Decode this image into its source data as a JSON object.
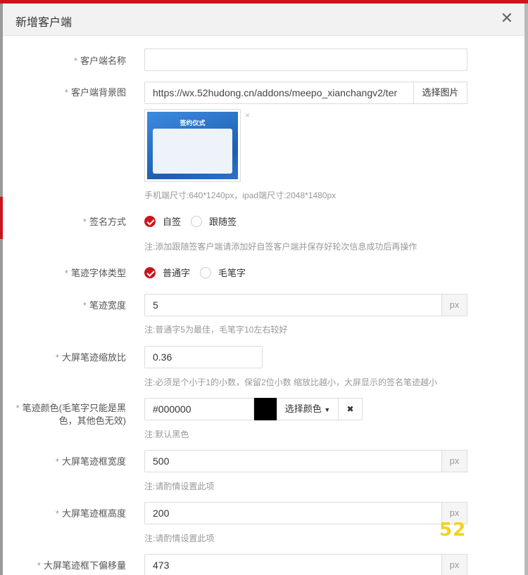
{
  "modal": {
    "title": "新增客户端",
    "close_icon": "close-icon"
  },
  "form": {
    "client_name": {
      "label": "客户端名称",
      "value": ""
    },
    "background": {
      "label": "客户端背景图",
      "value": "https://wx.52hudong.cn/addons/meepo_xianchangv2/ter",
      "button": "选择图片",
      "thumb_title": "签约仪式",
      "remove_icon": "×",
      "hint": "手机端尺寸:640*1240px，ipad端尺寸:2048*1480px"
    },
    "sign_mode": {
      "label": "签名方式",
      "options": [
        "自签",
        "跟随签"
      ],
      "selected": 0,
      "hint": "注:添加跟随签客户端请添加好自签客户端并保存好轮次信息成功后再操作"
    },
    "font_type": {
      "label": "笔迹字体类型",
      "options": [
        "普通字",
        "毛笔字"
      ],
      "selected": 0
    },
    "stroke_width": {
      "label": "笔迹宽度",
      "value": "5",
      "unit": "px",
      "hint": "注:普通字5为最佳，毛笔字10左右较好"
    },
    "screen_scale": {
      "label": "大屏笔迹缩放比",
      "value": "0.36",
      "hint": "注:必须是个小于1的小数，保留2位小数 缩放比越小，大屏显示的签名笔迹越小"
    },
    "stroke_color": {
      "label": "笔迹颜色(毛笔字只能是黑色，其他色无效)",
      "value": "#000000",
      "swatch": "#000000",
      "picker_button": "选择颜色",
      "clear_icon": "✖",
      "hint": "注:默认黑色"
    },
    "box_width": {
      "label": "大屏笔迹框宽度",
      "value": "500",
      "unit": "px",
      "hint": "注:请酌情设置此项"
    },
    "box_height": {
      "label": "大屏笔迹框高度",
      "value": "200",
      "unit": "px",
      "hint": "注:请酌情设置此项"
    },
    "box_offset": {
      "label": "大屏笔迹框下偏移量",
      "value": "473",
      "unit": "px"
    }
  },
  "watermark": "52",
  "colors": {
    "accent": "#c8161d",
    "watermark": "#f2d21c"
  }
}
